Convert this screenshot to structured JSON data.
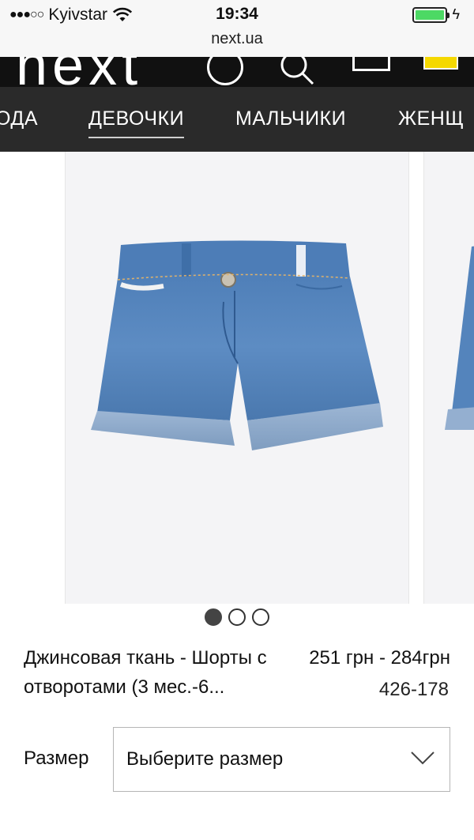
{
  "status_bar": {
    "carrier": "Kyivstar",
    "signal_dots": "●●●○○",
    "time": "19:34",
    "battery_color": "#4cd964"
  },
  "url_bar": {
    "domain": "next.ua"
  },
  "header": {
    "logo": "next",
    "icons": [
      "account-icon",
      "search-icon",
      "bag-icon"
    ]
  },
  "category_nav": {
    "items": [
      {
        "label": "ОДА",
        "active": false
      },
      {
        "label": "ДЕВОЧКИ",
        "active": true
      },
      {
        "label": "МАЛЬЧИКИ",
        "active": false
      },
      {
        "label": "ЖЕНЩ",
        "active": false
      }
    ]
  },
  "carousel": {
    "slide_count": 3,
    "active_index": 0,
    "image_subject": "denim shorts"
  },
  "product": {
    "name": "Джинсовая ткань - Шорты с отворотами (3 мес.-6...",
    "price": "251 грн - 284грн",
    "code": "426-178"
  },
  "size": {
    "label": "Размер",
    "placeholder": "Выберите размер"
  }
}
